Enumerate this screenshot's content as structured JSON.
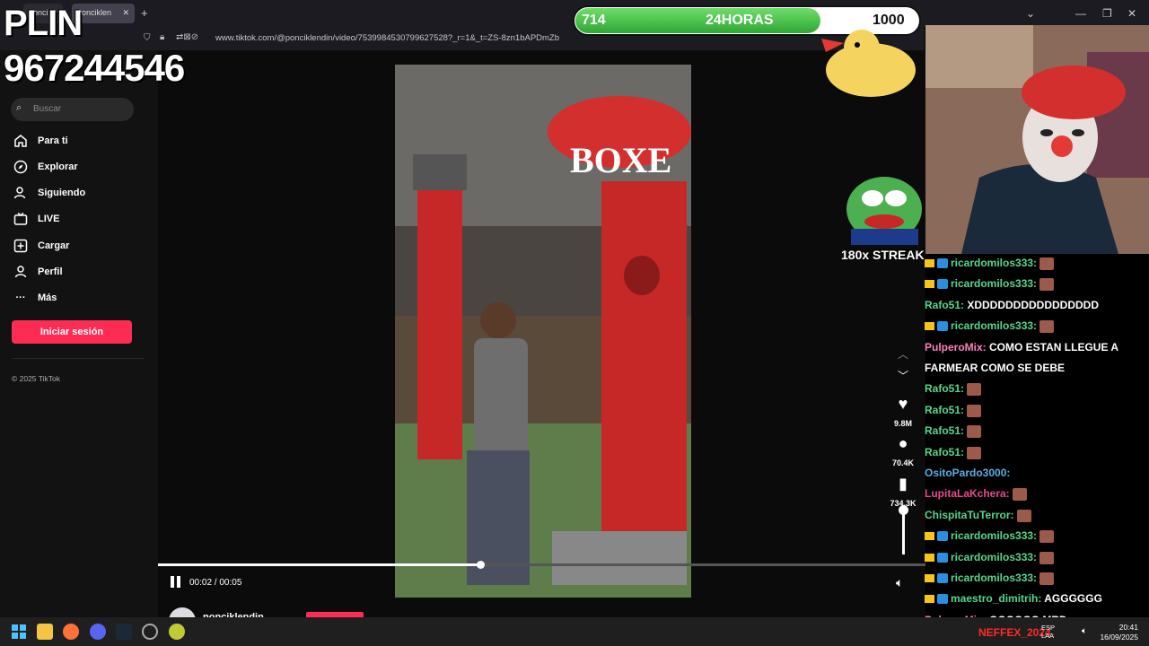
{
  "browser": {
    "tabs": [
      {
        "label": "ponci"
      },
      {
        "label": "ponciklen"
      }
    ],
    "url": "www.tiktok.com/@ponciklendin/video/7539984530799627528?_r=1&_t=ZS-8zn1bAPDmZb"
  },
  "overlay": {
    "plin": "PLIN",
    "phone": "967244546"
  },
  "sidebar": {
    "search_placeholder": "Buscar",
    "items": [
      {
        "label": "Para ti",
        "icon": "home-icon"
      },
      {
        "label": "Explorar",
        "icon": "compass-icon"
      },
      {
        "label": "Siguiendo",
        "icon": "user-icon"
      },
      {
        "label": "LIVE",
        "icon": "live-icon"
      },
      {
        "label": "Cargar",
        "icon": "upload-icon"
      },
      {
        "label": "Perfil",
        "icon": "profile-icon"
      },
      {
        "label": "Más",
        "icon": "more-icon"
      }
    ],
    "login_button": "Iniciar sesión",
    "copyright": "© 2025 TikTok"
  },
  "player": {
    "time": "00:02 / 00:05",
    "progress": 0.42,
    "username": "ponciklendin",
    "likes": "9.8M",
    "comments": "70.4K",
    "saves": "734.3K"
  },
  "goal": {
    "current": "714",
    "label": "24HORAS",
    "target": "1000",
    "fill": 0.714
  },
  "streak": "180x STREAK",
  "chat": [
    {
      "user": "ricardomilos333:",
      "msg": "",
      "color": "#58d68d",
      "badges": true,
      "emote": true
    },
    {
      "user": "ricardomilos333:",
      "msg": "",
      "color": "#58d68d",
      "badges": true,
      "emote": true
    },
    {
      "user": "Rafo51:",
      "msg": "XDDDDDDDDDDDDDDDD",
      "color": "#58d68d",
      "badges": false,
      "emote": false
    },
    {
      "user": "ricardomilos333:",
      "msg": "",
      "color": "#58d68d",
      "badges": true,
      "emote": true
    },
    {
      "user": "PulperoMix:",
      "msg": "COMO ESTAN LLEGUE A",
      "color": "#ff7fbf",
      "badges": false,
      "emote": false
    },
    {
      "user": "",
      "msg": "FARMEAR COMO SE DEBE",
      "color": "#ff7fbf",
      "badges": false,
      "emote": false
    },
    {
      "user": "Rafo51:",
      "msg": "",
      "color": "#58d68d",
      "badges": false,
      "emote": true
    },
    {
      "user": "Rafo51:",
      "msg": "",
      "color": "#58d68d",
      "badges": false,
      "emote": true
    },
    {
      "user": "Rafo51:",
      "msg": "",
      "color": "#58d68d",
      "badges": false,
      "emote": true
    },
    {
      "user": "Rafo51:",
      "msg": "",
      "color": "#58d68d",
      "badges": false,
      "emote": true
    },
    {
      "user": "OsitoPardo3000:",
      "msg": "",
      "color": "#5dade2",
      "badges": false,
      "emote": false
    },
    {
      "user": "LupitaLaKchera:",
      "msg": "",
      "color": "#e74c8c",
      "badges": false,
      "emote": true
    },
    {
      "user": "ChispitaTuTerror:",
      "msg": "",
      "color": "#58d68d",
      "badges": false,
      "emote": true
    },
    {
      "user": "ricardomilos333:",
      "msg": "",
      "color": "#58d68d",
      "badges": true,
      "emote": true
    },
    {
      "user": "ricardomilos333:",
      "msg": "",
      "color": "#58d68d",
      "badges": true,
      "emote": true
    },
    {
      "user": "ricardomilos333:",
      "msg": "",
      "color": "#58d68d",
      "badges": true,
      "emote": true
    },
    {
      "user": "maestro_dimitrih:",
      "msg": "AGGGGGG",
      "color": "#58d68d",
      "badges": true,
      "emote": false
    },
    {
      "user": "PulperoMix:",
      "msg": "GOGOGO MRD",
      "color": "#ff7fbf",
      "badges": false,
      "emote": false
    }
  ],
  "taskbar": {
    "lang_top": "ESP",
    "lang_bottom": "LAA",
    "time": "20:41",
    "date": "16/09/2025",
    "neffex": "NEFFEX_2024"
  },
  "colors": {
    "accent": "#fe2c55",
    "goal_green": "#2ea833"
  }
}
